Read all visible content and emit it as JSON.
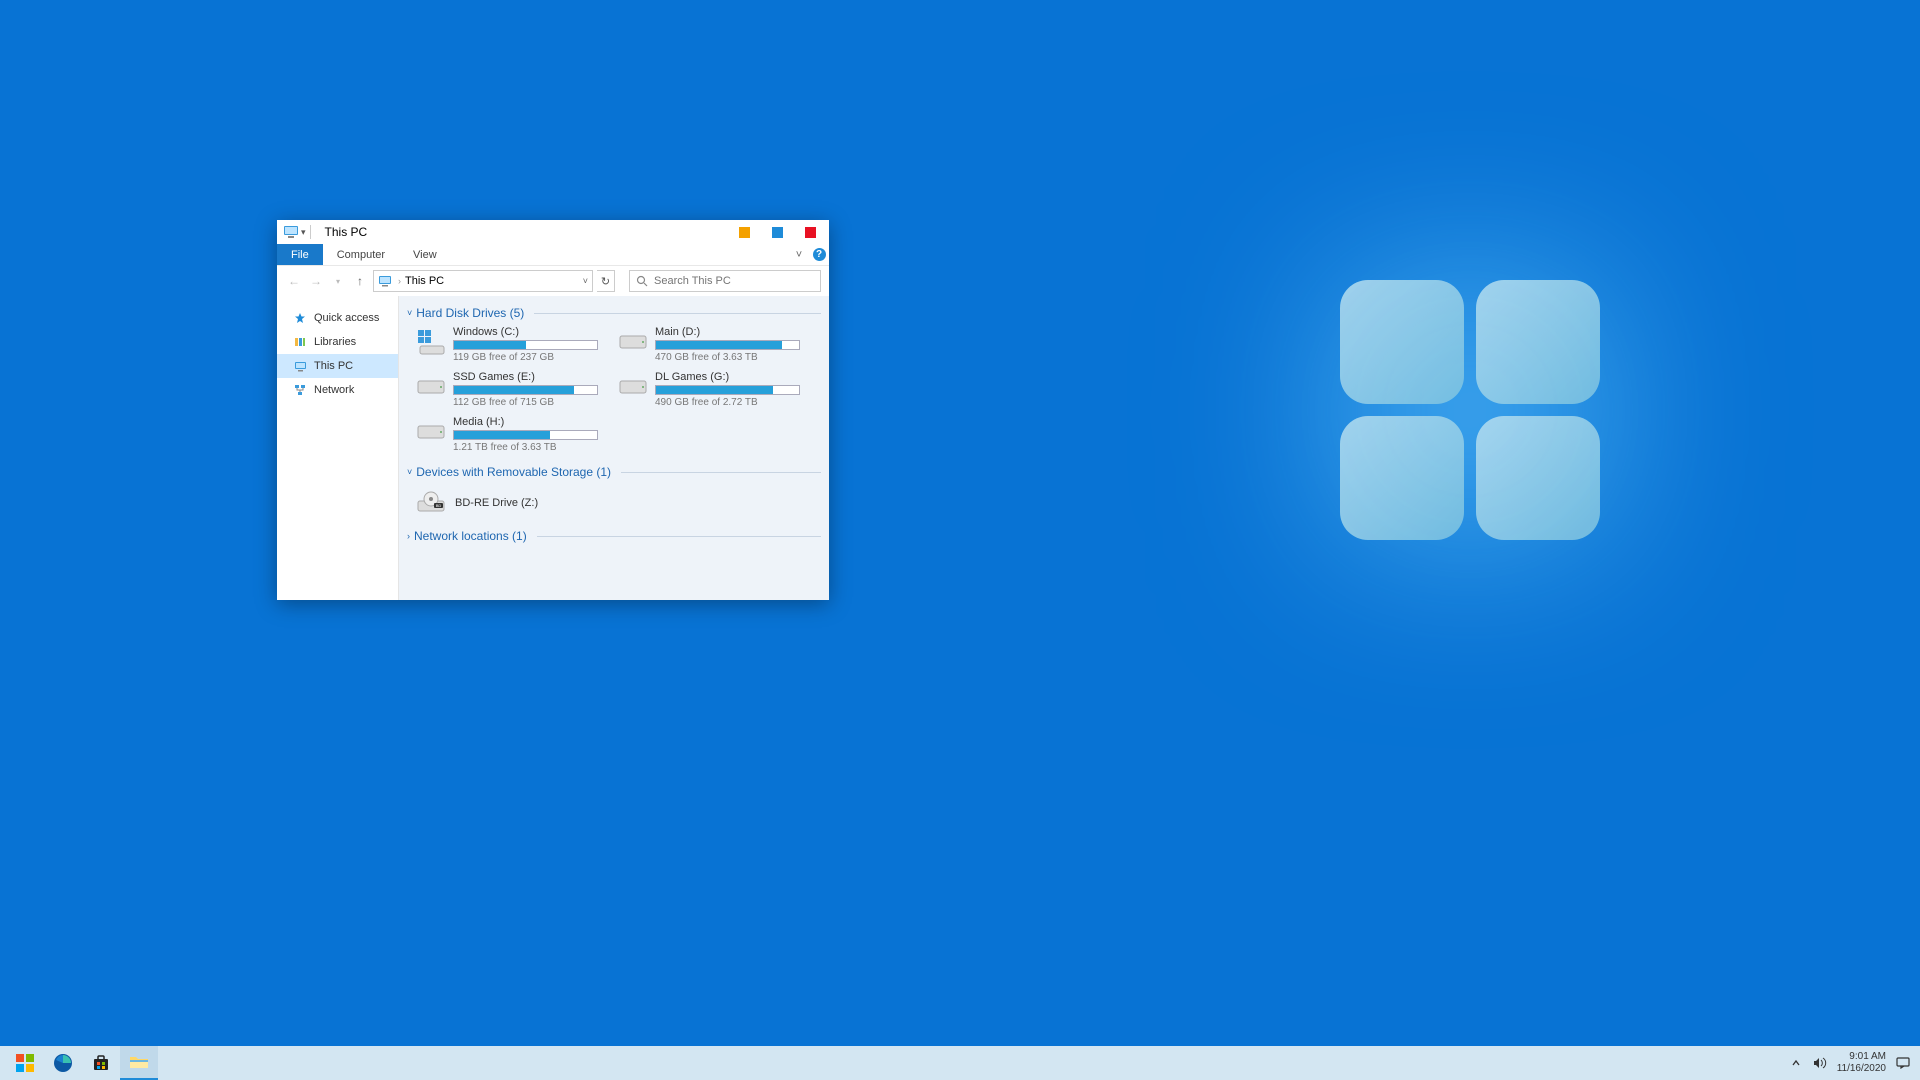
{
  "window": {
    "title": "This PC"
  },
  "ribbon": {
    "tabs": {
      "file": "File",
      "computer": "Computer",
      "view": "View"
    }
  },
  "address": {
    "crumb": "This PC"
  },
  "search": {
    "placeholder": "Search This PC"
  },
  "sidebar": {
    "items": [
      {
        "label": "Quick access"
      },
      {
        "label": "Libraries"
      },
      {
        "label": "This PC"
      },
      {
        "label": "Network"
      }
    ]
  },
  "sections": {
    "hdd_title": "Hard Disk Drives (5)",
    "removable_title": "Devices with Removable Storage (1)",
    "network_title": "Network locations (1)"
  },
  "drives": [
    {
      "name": "Windows  (C:)",
      "free": "119 GB free of 237 GB",
      "used_pct": 50
    },
    {
      "name": "Main (D:)",
      "free": "470 GB free of 3.63 TB",
      "used_pct": 88
    },
    {
      "name": "SSD Games (E:)",
      "free": "112 GB free of 715 GB",
      "used_pct": 84
    },
    {
      "name": "DL Games (G:)",
      "free": "490 GB free of 2.72 TB",
      "used_pct": 82
    },
    {
      "name": "Media (H:)",
      "free": "1.21 TB free of 3.63 TB",
      "used_pct": 67
    }
  ],
  "removable": {
    "name": "BD-RE Drive (Z:)"
  },
  "taskbar": {
    "time": "9:01 AM",
    "date": "11/16/2020"
  },
  "colors": {
    "accent": "#1e8bd8",
    "desktop": "#0873d4"
  }
}
